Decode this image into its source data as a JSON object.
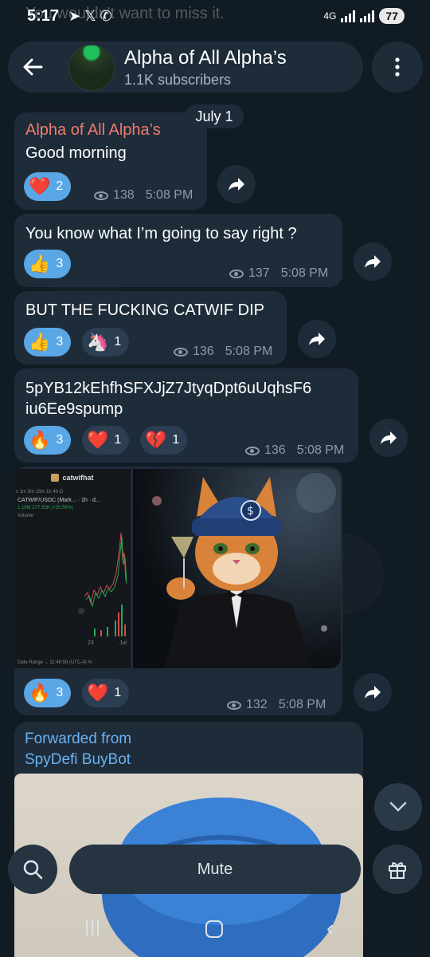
{
  "status": {
    "time": "5:17",
    "battery": "77",
    "network": "4G",
    "behind_text": "You wouldn't want to miss it."
  },
  "header": {
    "title": "Alpha of All Alpha’s",
    "subtitle": "1.1K subscribers"
  },
  "date_chip": "July 1",
  "messages": [
    {
      "sender": "Alpha of All Alpha’s",
      "text": "Good morning",
      "reactions": [
        {
          "emoji": "❤️",
          "count": "2"
        }
      ],
      "views": "138",
      "time": "5:08 PM"
    },
    {
      "text": "You know what I’m going to say right ?",
      "reactions": [
        {
          "emoji": "👍",
          "count": "3"
        }
      ],
      "views": "137",
      "time": "5:08 PM"
    },
    {
      "text": "BUT THE FUCKING CATWIF DIP",
      "reactions": [
        {
          "emoji": "👍",
          "count": "3"
        },
        {
          "emoji": "🦄",
          "count": "1"
        }
      ],
      "views": "136",
      "time": "5:08 PM"
    },
    {
      "text_line1": "5pYB12kEhfhSFXJjZ7JtyqDpt6uUqhsF6",
      "text_line2": "iu6Ee9spump",
      "reactions": [
        {
          "emoji": "🔥",
          "count": "3"
        },
        {
          "emoji": "❤️",
          "count": "1"
        },
        {
          "emoji": "💔",
          "count": "1"
        }
      ],
      "views": "136",
      "time": "5:08 PM"
    },
    {
      "media_chart": {
        "title": "catwifhat",
        "toolbar": "s  1m  5m  15m  1h  4h  D",
        "pair": "CATWIF/USDC (Mark... · 1h · d...",
        "volume_line": "1.18M  277.55K (+30.56%)",
        "volume_label": "Volume",
        "x_tick1": "23",
        "x_tick2": "Jul",
        "footer": "Date Range ⌄     11:48:59 (UTC-4)   %"
      },
      "reactions": [
        {
          "emoji": "🔥",
          "count": "3"
        },
        {
          "emoji": "❤️",
          "count": "1"
        }
      ],
      "views": "132",
      "time": "5:08 PM"
    },
    {
      "forward_label": "Forwarded from",
      "forward_source": "SpyDefi BuyBot"
    }
  ],
  "bottom": {
    "mute_label": "Mute"
  }
}
